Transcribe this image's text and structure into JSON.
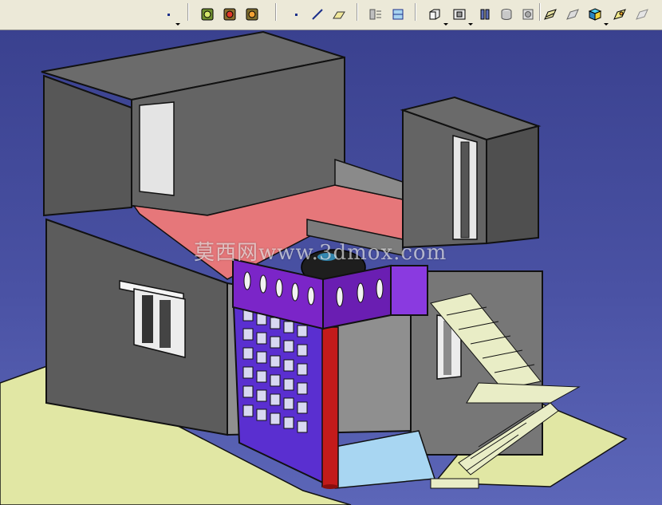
{
  "colors": {
    "background": "#3c4595",
    "toolbar": "#ece9d8",
    "wall": "#5c5c5c",
    "floor": "#e6777a",
    "balcony": "#7a23c8",
    "column": "#c71e1e",
    "stairs": "#e9edc6",
    "ground": "#e0e7a3"
  },
  "toolbar": {
    "icons": [
      "point-icon",
      "analysis-icon-green",
      "analysis-icon-red",
      "analysis-icon-orange",
      "point-icon",
      "line-icon",
      "plane-icon",
      "grid-icon",
      "sketch-icon",
      "pad-icon",
      "pocket-icon",
      "shaft-icon",
      "hole-icon",
      "groove-icon",
      "rib-icon",
      "slot-icon",
      "cube-icon",
      "draft-icon",
      "shell-icon"
    ]
  },
  "viewport": {
    "watermark": "莫西网www.3dmox.com"
  }
}
